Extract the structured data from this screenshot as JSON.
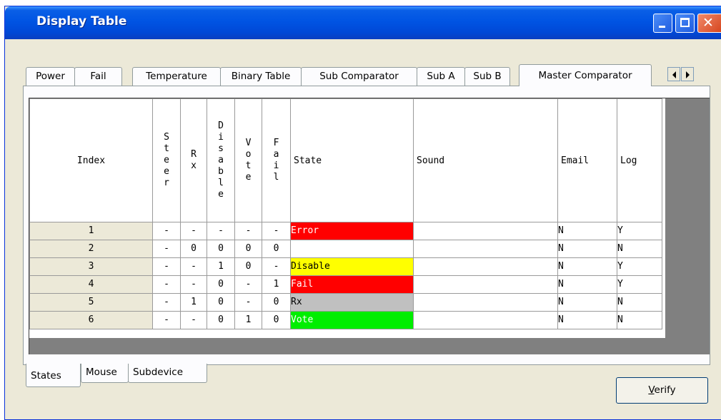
{
  "window": {
    "title": "Display Table"
  },
  "top_tabs": [
    "Power",
    "Fail",
    "Temperature",
    "Binary Table",
    "Sub Comparator",
    "Sub A",
    "Sub B",
    "Master Comparator"
  ],
  "active_top_tab": "Master Comparator",
  "bottom_tabs": [
    "States",
    "Mouse",
    "Subdevice"
  ],
  "active_bottom_tab": "States",
  "verify_button": {
    "prefix": "V",
    "rest": "erify"
  },
  "table": {
    "headers": {
      "index": "Index",
      "steer": "Steer",
      "rx": "Rx",
      "disable": "Disable",
      "vote": "Vote",
      "fail": "Fail",
      "state": "State",
      "sound": "Sound",
      "email": "Email",
      "log": "Log"
    },
    "rows": [
      {
        "index": "1",
        "steer": "-",
        "rx": "-",
        "disable": "-",
        "vote": "-",
        "fail": "-",
        "state": "Error",
        "state_color": "#ff0000",
        "state_text_color": "#ffffff",
        "sound": "",
        "email": "N",
        "log": "Y"
      },
      {
        "index": "2",
        "steer": "-",
        "rx": "0",
        "disable": "0",
        "vote": "0",
        "fail": "0",
        "state": "",
        "state_color": "#ffffff",
        "state_text_color": "#000000",
        "sound": "",
        "email": "N",
        "log": "N"
      },
      {
        "index": "3",
        "steer": "-",
        "rx": "-",
        "disable": "1",
        "vote": "0",
        "fail": "-",
        "state": "Disable",
        "state_color": "#ffff00",
        "state_text_color": "#000000",
        "sound": "",
        "email": "N",
        "log": "Y"
      },
      {
        "index": "4",
        "steer": "-",
        "rx": "-",
        "disable": "0",
        "vote": "-",
        "fail": "1",
        "state": "Fail",
        "state_color": "#ff0000",
        "state_text_color": "#ffffff",
        "sound": "",
        "email": "N",
        "log": "Y"
      },
      {
        "index": "5",
        "steer": "-",
        "rx": "1",
        "disable": "0",
        "vote": "-",
        "fail": "0",
        "state": "Rx",
        "state_color": "#c0c0c0",
        "state_text_color": "#000000",
        "sound": "",
        "email": "N",
        "log": "N"
      },
      {
        "index": "6",
        "steer": "-",
        "rx": "-",
        "disable": "0",
        "vote": "1",
        "fail": "0",
        "state": "Vote",
        "state_color": "#00ee00",
        "state_text_color": "#ffffff",
        "sound": "",
        "email": "N",
        "log": "N"
      }
    ]
  }
}
